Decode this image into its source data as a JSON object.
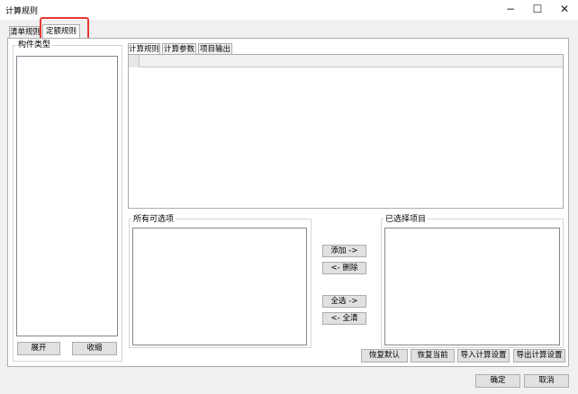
{
  "window": {
    "title": "计算规则",
    "minimize": "−",
    "maximize": "☐",
    "close": "✕"
  },
  "tabs": [
    {
      "label": "清单规则"
    },
    {
      "label": "定额规则"
    }
  ],
  "left": {
    "group_label": "构件类型",
    "expand": "展开",
    "collapse": "收缩"
  },
  "subtabs": [
    {
      "label": "计算规则"
    },
    {
      "label": "计算参数"
    },
    {
      "label": "项目输出"
    }
  ],
  "available": {
    "label": "所有可选项"
  },
  "selected": {
    "label": "已选择项目"
  },
  "middle": {
    "add": "添加 ->",
    "remove": "<- 删除",
    "select_all": "全选 ->",
    "clear_all": "<- 全清"
  },
  "bottom_buttons": {
    "restore_default": "恢复默认",
    "restore_current": "恢复当前",
    "import_settings": "导入计算设置",
    "export_settings": "导出计算设置"
  },
  "footer": {
    "ok": "确定",
    "cancel": "取消"
  }
}
